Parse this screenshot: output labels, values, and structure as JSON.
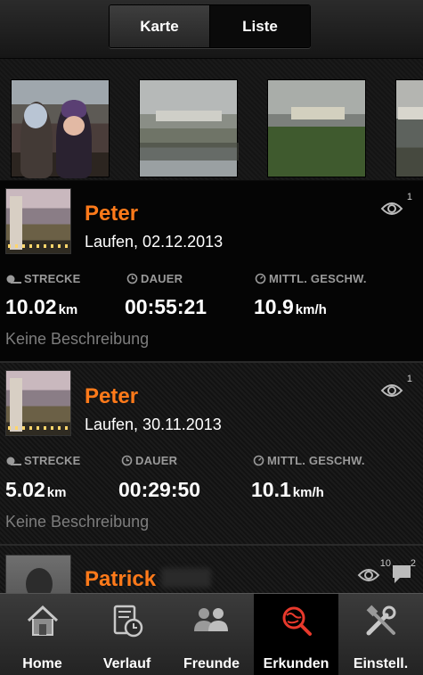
{
  "topbar": {
    "tabs": [
      {
        "label": "Karte"
      },
      {
        "label": "Liste"
      }
    ]
  },
  "feed": [
    {
      "name": "Peter",
      "subtitle": "Laufen, 02.12.2013",
      "views": "1",
      "stats": [
        {
          "label": "STRECKE",
          "value": "10.02",
          "unit": "km"
        },
        {
          "label": "DAUER",
          "value": "00:55:21",
          "unit": ""
        },
        {
          "label": "MITTL. GESCHW.",
          "value": "10.9",
          "unit": "km/h"
        }
      ],
      "description": "Keine Beschreibung"
    },
    {
      "name": "Peter",
      "subtitle": "Laufen, 30.11.2013",
      "views": "1",
      "stats": [
        {
          "label": "STRECKE",
          "value": "5.02",
          "unit": "km"
        },
        {
          "label": "DAUER",
          "value": "00:29:50",
          "unit": ""
        },
        {
          "label": "MITTL. GESCHW.",
          "value": "10.1",
          "unit": "km/h"
        }
      ],
      "description": "Keine Beschreibung"
    },
    {
      "name": "Patrick",
      "views": "10",
      "comments": "2"
    }
  ],
  "nav": [
    {
      "label": "Home",
      "icon": "home-icon"
    },
    {
      "label": "Verlauf",
      "icon": "history-icon"
    },
    {
      "label": "Freunde",
      "icon": "friends-icon"
    },
    {
      "label": "Erkunden",
      "icon": "explore-icon",
      "active": true
    },
    {
      "label": "Einstell.",
      "icon": "settings-icon"
    }
  ],
  "colors": {
    "accent": "#ff7a1a",
    "explore_icon": "#e8392c"
  }
}
